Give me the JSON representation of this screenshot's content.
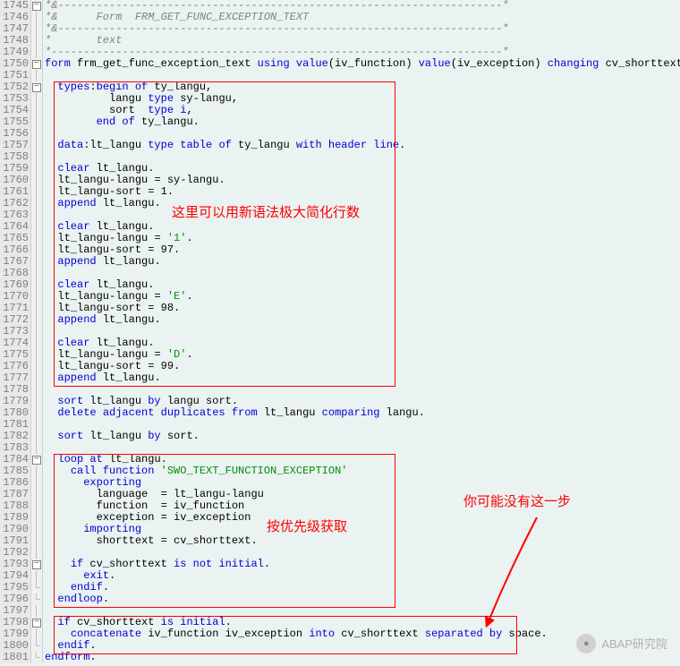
{
  "startLine": 1745,
  "annotations": {
    "a1": "这里可以用新语法极大简化行数",
    "a2": "按优先级获取",
    "a3": "你可能没有这一步"
  },
  "watermark": "ABAP研究院",
  "code": [
    {
      "n": 1745,
      "f": "m",
      "seg": [
        [
          "cm",
          "*&---------------------------------------------------------------------*"
        ]
      ]
    },
    {
      "n": 1746,
      "f": "b",
      "seg": [
        [
          "cm",
          "*&      Form  FRM_GET_FUNC_EXCEPTION_TEXT"
        ]
      ]
    },
    {
      "n": 1747,
      "f": "b",
      "seg": [
        [
          "cm",
          "*&---------------------------------------------------------------------*"
        ]
      ]
    },
    {
      "n": 1748,
      "f": "b",
      "seg": [
        [
          "cm",
          "*       text"
        ]
      ]
    },
    {
      "n": 1749,
      "f": "b",
      "seg": [
        [
          "cm",
          "*----------------------------------------------------------------------*"
        ]
      ]
    },
    {
      "n": 1750,
      "f": "m",
      "seg": [
        [
          "kw",
          "form"
        ],
        [
          "id",
          " frm_get_func_exception_text "
        ],
        [
          "kw",
          "using"
        ],
        [
          "id",
          " "
        ],
        [
          "kw",
          "value"
        ],
        [
          "op",
          "("
        ],
        [
          "id",
          "iv_function"
        ],
        [
          "op",
          ") "
        ],
        [
          "kw",
          "value"
        ],
        [
          "op",
          "("
        ],
        [
          "id",
          "iv_exception"
        ],
        [
          "op",
          ") "
        ],
        [
          "kw",
          "changing"
        ],
        [
          "id",
          " cv_shorttext"
        ],
        [
          "op",
          "."
        ]
      ]
    },
    {
      "n": 1751,
      "f": "b",
      "seg": [
        [
          "id",
          ""
        ]
      ]
    },
    {
      "n": 1752,
      "f": "m",
      "seg": [
        [
          "id",
          "  "
        ],
        [
          "kw",
          "types"
        ],
        [
          "op",
          ":"
        ],
        [
          "kw",
          "begin of"
        ],
        [
          "id",
          " ty_langu"
        ],
        [
          "op",
          ","
        ]
      ]
    },
    {
      "n": 1753,
      "f": "b",
      "seg": [
        [
          "id",
          "          langu "
        ],
        [
          "kw",
          "type"
        ],
        [
          "id",
          " sy"
        ],
        [
          "op",
          "-"
        ],
        [
          "id",
          "langu"
        ],
        [
          "op",
          ","
        ]
      ]
    },
    {
      "n": 1754,
      "f": "b",
      "seg": [
        [
          "id",
          "          sort  "
        ],
        [
          "kw",
          "type i"
        ],
        [
          "op",
          ","
        ]
      ]
    },
    {
      "n": 1755,
      "f": "b",
      "seg": [
        [
          "id",
          "        "
        ],
        [
          "kw",
          "end of"
        ],
        [
          "id",
          " ty_langu"
        ],
        [
          "op",
          "."
        ]
      ]
    },
    {
      "n": 1756,
      "f": "b",
      "seg": [
        [
          "id",
          ""
        ]
      ]
    },
    {
      "n": 1757,
      "f": "b",
      "seg": [
        [
          "id",
          "  "
        ],
        [
          "kw",
          "data"
        ],
        [
          "op",
          ":"
        ],
        [
          "id",
          "lt_langu "
        ],
        [
          "kw",
          "type table of"
        ],
        [
          "id",
          " ty_langu "
        ],
        [
          "kw",
          "with header line"
        ],
        [
          "op",
          "."
        ]
      ]
    },
    {
      "n": 1758,
      "f": "b",
      "seg": [
        [
          "id",
          ""
        ]
      ]
    },
    {
      "n": 1759,
      "f": "b",
      "seg": [
        [
          "id",
          "  "
        ],
        [
          "kw",
          "clear"
        ],
        [
          "id",
          " lt_langu"
        ],
        [
          "op",
          "."
        ]
      ]
    },
    {
      "n": 1760,
      "f": "b",
      "seg": [
        [
          "id",
          "  lt_langu"
        ],
        [
          "op",
          "-"
        ],
        [
          "id",
          "langu "
        ],
        [
          "op",
          "="
        ],
        [
          "id",
          " sy"
        ],
        [
          "op",
          "-"
        ],
        [
          "id",
          "langu"
        ],
        [
          "op",
          "."
        ]
      ]
    },
    {
      "n": 1761,
      "f": "b",
      "seg": [
        [
          "id",
          "  lt_langu"
        ],
        [
          "op",
          "-"
        ],
        [
          "id",
          "sort "
        ],
        [
          "op",
          "= "
        ],
        [
          "num",
          "1"
        ],
        [
          "op",
          "."
        ]
      ]
    },
    {
      "n": 1762,
      "f": "b",
      "seg": [
        [
          "id",
          "  "
        ],
        [
          "kw",
          "append"
        ],
        [
          "id",
          " lt_langu"
        ],
        [
          "op",
          "."
        ]
      ]
    },
    {
      "n": 1763,
      "f": "b",
      "seg": [
        [
          "id",
          ""
        ]
      ]
    },
    {
      "n": 1764,
      "f": "b",
      "seg": [
        [
          "id",
          "  "
        ],
        [
          "kw",
          "clear"
        ],
        [
          "id",
          " lt_langu"
        ],
        [
          "op",
          "."
        ]
      ]
    },
    {
      "n": 1765,
      "f": "b",
      "seg": [
        [
          "id",
          "  lt_langu"
        ],
        [
          "op",
          "-"
        ],
        [
          "id",
          "langu "
        ],
        [
          "op",
          "= "
        ],
        [
          "str",
          "'1'"
        ],
        [
          "op",
          "."
        ]
      ]
    },
    {
      "n": 1766,
      "f": "b",
      "seg": [
        [
          "id",
          "  lt_langu"
        ],
        [
          "op",
          "-"
        ],
        [
          "id",
          "sort "
        ],
        [
          "op",
          "= "
        ],
        [
          "num",
          "97"
        ],
        [
          "op",
          "."
        ]
      ]
    },
    {
      "n": 1767,
      "f": "b",
      "seg": [
        [
          "id",
          "  "
        ],
        [
          "kw",
          "append"
        ],
        [
          "id",
          " lt_langu"
        ],
        [
          "op",
          "."
        ]
      ]
    },
    {
      "n": 1768,
      "f": "b",
      "seg": [
        [
          "id",
          ""
        ]
      ]
    },
    {
      "n": 1769,
      "f": "b",
      "seg": [
        [
          "id",
          "  "
        ],
        [
          "kw",
          "clear"
        ],
        [
          "id",
          " lt_langu"
        ],
        [
          "op",
          "."
        ]
      ]
    },
    {
      "n": 1770,
      "f": "b",
      "seg": [
        [
          "id",
          "  lt_langu"
        ],
        [
          "op",
          "-"
        ],
        [
          "id",
          "langu "
        ],
        [
          "op",
          "= "
        ],
        [
          "str",
          "'E'"
        ],
        [
          "op",
          "."
        ]
      ]
    },
    {
      "n": 1771,
      "f": "b",
      "seg": [
        [
          "id",
          "  lt_langu"
        ],
        [
          "op",
          "-"
        ],
        [
          "id",
          "sort "
        ],
        [
          "op",
          "= "
        ],
        [
          "num",
          "98"
        ],
        [
          "op",
          "."
        ]
      ]
    },
    {
      "n": 1772,
      "f": "b",
      "seg": [
        [
          "id",
          "  "
        ],
        [
          "kw",
          "append"
        ],
        [
          "id",
          " lt_langu"
        ],
        [
          "op",
          "."
        ]
      ]
    },
    {
      "n": 1773,
      "f": "b",
      "seg": [
        [
          "id",
          ""
        ]
      ]
    },
    {
      "n": 1774,
      "f": "b",
      "seg": [
        [
          "id",
          "  "
        ],
        [
          "kw",
          "clear"
        ],
        [
          "id",
          " lt_langu"
        ],
        [
          "op",
          "."
        ]
      ]
    },
    {
      "n": 1775,
      "f": "b",
      "seg": [
        [
          "id",
          "  lt_langu"
        ],
        [
          "op",
          "-"
        ],
        [
          "id",
          "langu "
        ],
        [
          "op",
          "= "
        ],
        [
          "str",
          "'D'"
        ],
        [
          "op",
          "."
        ]
      ]
    },
    {
      "n": 1776,
      "f": "b",
      "seg": [
        [
          "id",
          "  lt_langu"
        ],
        [
          "op",
          "-"
        ],
        [
          "id",
          "sort "
        ],
        [
          "op",
          "= "
        ],
        [
          "num",
          "99"
        ],
        [
          "op",
          "."
        ]
      ]
    },
    {
      "n": 1777,
      "f": "b",
      "seg": [
        [
          "id",
          "  "
        ],
        [
          "kw",
          "append"
        ],
        [
          "id",
          " lt_langu"
        ],
        [
          "op",
          "."
        ]
      ]
    },
    {
      "n": 1778,
      "f": "b",
      "seg": [
        [
          "id",
          ""
        ]
      ]
    },
    {
      "n": 1779,
      "f": "b",
      "seg": [
        [
          "id",
          "  "
        ],
        [
          "kw",
          "sort"
        ],
        [
          "id",
          " lt_langu "
        ],
        [
          "kw",
          "by"
        ],
        [
          "id",
          " langu sort"
        ],
        [
          "op",
          "."
        ]
      ]
    },
    {
      "n": 1780,
      "f": "b",
      "seg": [
        [
          "id",
          "  "
        ],
        [
          "kw",
          "delete adjacent duplicates from"
        ],
        [
          "id",
          " lt_langu "
        ],
        [
          "kw",
          "comparing"
        ],
        [
          "id",
          " langu"
        ],
        [
          "op",
          "."
        ]
      ]
    },
    {
      "n": 1781,
      "f": "b",
      "seg": [
        [
          "id",
          ""
        ]
      ]
    },
    {
      "n": 1782,
      "f": "b",
      "seg": [
        [
          "id",
          "  "
        ],
        [
          "kw",
          "sort"
        ],
        [
          "id",
          " lt_langu "
        ],
        [
          "kw",
          "by"
        ],
        [
          "id",
          " sort"
        ],
        [
          "op",
          "."
        ]
      ]
    },
    {
      "n": 1783,
      "f": "b",
      "seg": [
        [
          "id",
          ""
        ]
      ]
    },
    {
      "n": 1784,
      "f": "m",
      "seg": [
        [
          "id",
          "  "
        ],
        [
          "kw",
          "loop at"
        ],
        [
          "id",
          " lt_langu"
        ],
        [
          "op",
          "."
        ]
      ]
    },
    {
      "n": 1785,
      "f": "b",
      "seg": [
        [
          "id",
          "    "
        ],
        [
          "kw",
          "call function"
        ],
        [
          "id",
          " "
        ],
        [
          "str",
          "'SWO_TEXT_FUNCTION_EXCEPTION'"
        ]
      ]
    },
    {
      "n": 1786,
      "f": "b",
      "seg": [
        [
          "id",
          "      "
        ],
        [
          "kw",
          "exporting"
        ]
      ]
    },
    {
      "n": 1787,
      "f": "b",
      "seg": [
        [
          "id",
          "        language  "
        ],
        [
          "op",
          "="
        ],
        [
          "id",
          " lt_langu"
        ],
        [
          "op",
          "-"
        ],
        [
          "id",
          "langu"
        ]
      ]
    },
    {
      "n": 1788,
      "f": "b",
      "seg": [
        [
          "id",
          "        function  "
        ],
        [
          "op",
          "="
        ],
        [
          "id",
          " iv_function"
        ]
      ]
    },
    {
      "n": 1789,
      "f": "b",
      "seg": [
        [
          "id",
          "        exception "
        ],
        [
          "op",
          "="
        ],
        [
          "id",
          " iv_exception"
        ]
      ]
    },
    {
      "n": 1790,
      "f": "b",
      "seg": [
        [
          "id",
          "      "
        ],
        [
          "kw",
          "importing"
        ]
      ]
    },
    {
      "n": 1791,
      "f": "b",
      "seg": [
        [
          "id",
          "        shorttext "
        ],
        [
          "op",
          "="
        ],
        [
          "id",
          " cv_shorttext"
        ],
        [
          "op",
          "."
        ]
      ]
    },
    {
      "n": 1792,
      "f": "b",
      "seg": [
        [
          "id",
          ""
        ]
      ]
    },
    {
      "n": 1793,
      "f": "m",
      "seg": [
        [
          "id",
          "    "
        ],
        [
          "kw",
          "if"
        ],
        [
          "id",
          " cv_shorttext "
        ],
        [
          "kw",
          "is not initial"
        ],
        [
          "op",
          "."
        ]
      ]
    },
    {
      "n": 1794,
      "f": "b",
      "seg": [
        [
          "id",
          "      "
        ],
        [
          "kw",
          "exit"
        ],
        [
          "op",
          "."
        ]
      ]
    },
    {
      "n": 1795,
      "f": "e",
      "seg": [
        [
          "id",
          "    "
        ],
        [
          "kw",
          "endif"
        ],
        [
          "op",
          "."
        ]
      ]
    },
    {
      "n": 1796,
      "f": "e",
      "seg": [
        [
          "id",
          "  "
        ],
        [
          "kw",
          "endloop"
        ],
        [
          "op",
          "."
        ]
      ]
    },
    {
      "n": 1797,
      "f": "b",
      "seg": [
        [
          "id",
          ""
        ]
      ]
    },
    {
      "n": 1798,
      "f": "m",
      "seg": [
        [
          "id",
          "  "
        ],
        [
          "kw",
          "if"
        ],
        [
          "id",
          " cv_shorttext "
        ],
        [
          "kw",
          "is initial"
        ],
        [
          "op",
          "."
        ]
      ]
    },
    {
      "n": 1799,
      "f": "b",
      "seg": [
        [
          "id",
          "    "
        ],
        [
          "kw",
          "concatenate"
        ],
        [
          "id",
          " iv_function iv_exception "
        ],
        [
          "kw",
          "into"
        ],
        [
          "id",
          " cv_shorttext "
        ],
        [
          "kw",
          "separated by"
        ],
        [
          "id",
          " space"
        ],
        [
          "op",
          "."
        ]
      ]
    },
    {
      "n": 1800,
      "f": "e",
      "seg": [
        [
          "id",
          "  "
        ],
        [
          "kw",
          "endif"
        ],
        [
          "op",
          "."
        ]
      ]
    },
    {
      "n": 1801,
      "f": "e",
      "seg": [
        [
          "kw",
          "endform"
        ],
        [
          "op",
          "."
        ]
      ]
    }
  ]
}
